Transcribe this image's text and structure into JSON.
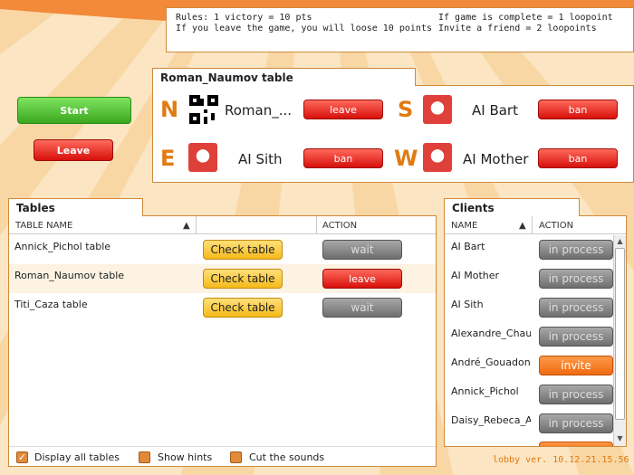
{
  "rules": {
    "line1_left": "Rules: 1 victory = 10 pts",
    "line2_left": "If you leave the game, you will loose 10 points",
    "line1_right": "If game is complete = 1 loopoint",
    "line2_right": "Invite a friend = 2 loopoints"
  },
  "actions": {
    "start_label": "Start",
    "leave_label": "Leave"
  },
  "table": {
    "title": "Roman_Naumov table",
    "seats": [
      {
        "letter": "N",
        "player": "Roman_...",
        "button": "leave",
        "avatar": "qr-code-avatar"
      },
      {
        "letter": "S",
        "player": "AI Bart",
        "button": "ban",
        "avatar": "bird-avatar"
      },
      {
        "letter": "E",
        "player": "AI Sith",
        "button": "ban",
        "avatar": "bird-avatar"
      },
      {
        "letter": "W",
        "player": "AI Mother",
        "button": "ban",
        "avatar": "bird-avatar"
      }
    ]
  },
  "tables_panel": {
    "title": "Tables",
    "col_name": "TABLE NAME",
    "col_action": "ACTION",
    "rows": [
      {
        "name": "Annick_Pichol table",
        "check": "Check table",
        "action": "wait",
        "action_style": "gray"
      },
      {
        "name": "Roman_Naumov table",
        "check": "Check table",
        "action": "leave",
        "action_style": "red"
      },
      {
        "name": "Titi_Caza table",
        "check": "Check table",
        "action": "wait",
        "action_style": "gray"
      }
    ]
  },
  "clients_panel": {
    "title": "Clients",
    "col_name": "NAME",
    "col_action": "ACTION",
    "rows": [
      {
        "name": "AI Bart",
        "action": "in process",
        "action_style": "gray"
      },
      {
        "name": "AI Mother",
        "action": "in process",
        "action_style": "gray"
      },
      {
        "name": "AI Sith",
        "action": "in process",
        "action_style": "gray"
      },
      {
        "name": "Alexandre_Chau",
        "action": "in process",
        "action_style": "gray"
      },
      {
        "name": "André_Gouadon",
        "action": "invite",
        "action_style": "orange"
      },
      {
        "name": "Annick_Pichol",
        "action": "in process",
        "action_style": "gray"
      },
      {
        "name": "Daisy_Rebeca_A",
        "action": "in process",
        "action_style": "gray"
      }
    ]
  },
  "options": {
    "display_all_tables": {
      "label": "Display all tables",
      "checked": true
    },
    "show_hints": {
      "label": "Show hints",
      "checked": false
    },
    "cut_sounds": {
      "label": "Cut the sounds",
      "checked": false
    }
  },
  "footer": {
    "version": "lobby ver. 10.12.21.15.56"
  },
  "colors": {
    "accent_orange": "#e07a12",
    "background": "#fbe5c2",
    "border": "#d08a3c"
  }
}
